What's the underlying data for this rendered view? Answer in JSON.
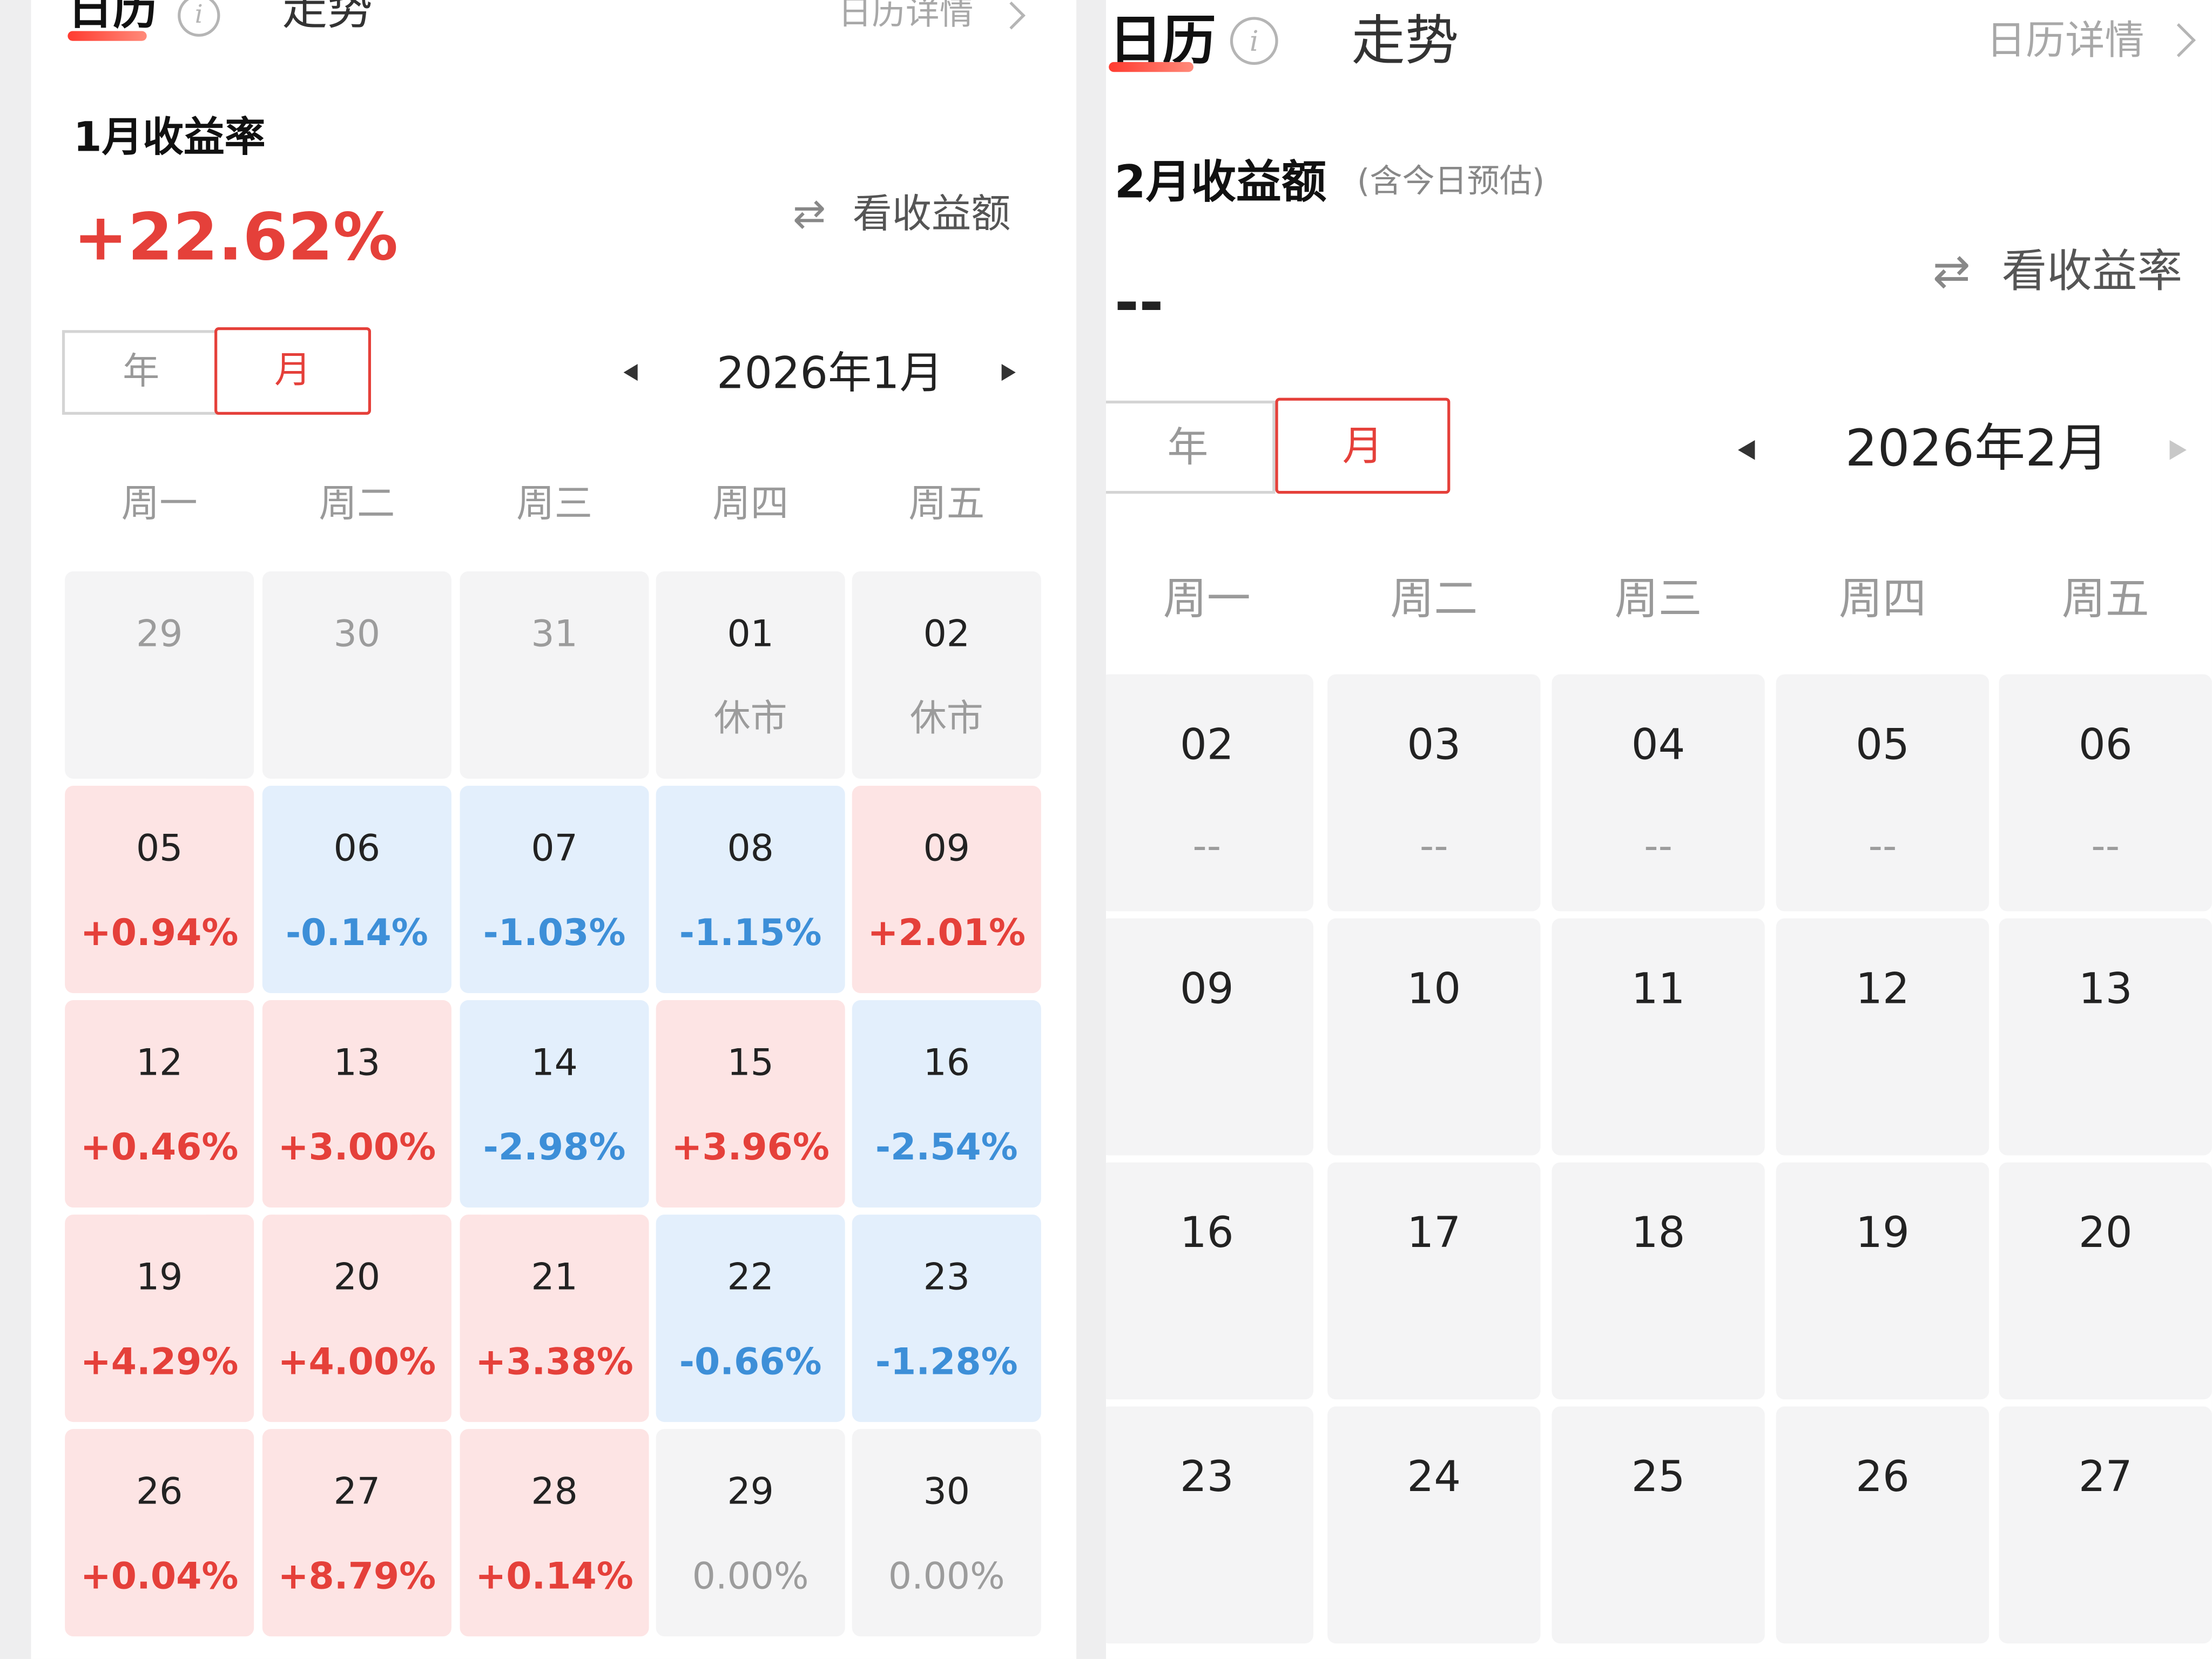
{
  "left": {
    "tabs": {
      "calendar": "日历",
      "trend": "走势"
    },
    "info_icon": "info-icon",
    "detail_link": "日历详情",
    "title": "1月收益率",
    "big_value": "+22.62%",
    "toggle_label": "看收益额",
    "segment": {
      "year": "年",
      "month": "月",
      "selected": "month"
    },
    "month_label": "2026年1月",
    "weekdays": [
      "周一",
      "周二",
      "周三",
      "周四",
      "周五"
    ],
    "weeks": [
      [
        {
          "day": "29",
          "value": "",
          "tone": "muted"
        },
        {
          "day": "30",
          "value": "",
          "tone": "muted"
        },
        {
          "day": "31",
          "value": "",
          "tone": "muted"
        },
        {
          "day": "01",
          "value": "休市",
          "tone": "gray"
        },
        {
          "day": "02",
          "value": "休市",
          "tone": "gray"
        }
      ],
      [
        {
          "day": "05",
          "value": "+0.94%",
          "tone": "red"
        },
        {
          "day": "06",
          "value": "-0.14%",
          "tone": "blue"
        },
        {
          "day": "07",
          "value": "-1.03%",
          "tone": "blue"
        },
        {
          "day": "08",
          "value": "-1.15%",
          "tone": "blue"
        },
        {
          "day": "09",
          "value": "+2.01%",
          "tone": "red"
        }
      ],
      [
        {
          "day": "12",
          "value": "+0.46%",
          "tone": "red"
        },
        {
          "day": "13",
          "value": "+3.00%",
          "tone": "red"
        },
        {
          "day": "14",
          "value": "-2.98%",
          "tone": "blue"
        },
        {
          "day": "15",
          "value": "+3.96%",
          "tone": "red"
        },
        {
          "day": "16",
          "value": "-2.54%",
          "tone": "blue"
        }
      ],
      [
        {
          "day": "19",
          "value": "+4.29%",
          "tone": "red"
        },
        {
          "day": "20",
          "value": "+4.00%",
          "tone": "red"
        },
        {
          "day": "21",
          "value": "+3.38%",
          "tone": "red"
        },
        {
          "day": "22",
          "value": "-0.66%",
          "tone": "blue"
        },
        {
          "day": "23",
          "value": "-1.28%",
          "tone": "blue"
        }
      ],
      [
        {
          "day": "26",
          "value": "+0.04%",
          "tone": "red"
        },
        {
          "day": "27",
          "value": "+8.79%",
          "tone": "red"
        },
        {
          "day": "28",
          "value": "+0.14%",
          "tone": "red"
        },
        {
          "day": "29",
          "value": "0.00%",
          "tone": "gray"
        },
        {
          "day": "30",
          "value": "0.00%",
          "tone": "gray"
        }
      ]
    ]
  },
  "right": {
    "tabs": {
      "calendar": "日历",
      "trend": "走势"
    },
    "info_icon": "info-icon",
    "detail_link": "日历详情",
    "title": "2月收益额",
    "title_hint": "(含今日预估)",
    "big_value": "--",
    "toggle_label": "看收益率",
    "segment": {
      "year": "年",
      "month": "月",
      "selected": "month"
    },
    "month_label": "2026年2月",
    "weekdays": [
      "周一",
      "周二",
      "周三",
      "周四",
      "周五"
    ],
    "weeks": [
      [
        {
          "day": "02",
          "value": "--",
          "tone": "gray"
        },
        {
          "day": "03",
          "value": "--",
          "tone": "gray"
        },
        {
          "day": "04",
          "value": "--",
          "tone": "gray"
        },
        {
          "day": "05",
          "value": "--",
          "tone": "gray"
        },
        {
          "day": "06",
          "value": "--",
          "tone": "gray"
        }
      ],
      [
        {
          "day": "09",
          "value": "",
          "tone": "gray"
        },
        {
          "day": "10",
          "value": "",
          "tone": "gray"
        },
        {
          "day": "11",
          "value": "",
          "tone": "gray"
        },
        {
          "day": "12",
          "value": "",
          "tone": "gray"
        },
        {
          "day": "13",
          "value": "",
          "tone": "gray"
        }
      ],
      [
        {
          "day": "16",
          "value": "",
          "tone": "gray"
        },
        {
          "day": "17",
          "value": "",
          "tone": "gray"
        },
        {
          "day": "18",
          "value": "",
          "tone": "gray"
        },
        {
          "day": "19",
          "value": "",
          "tone": "gray"
        },
        {
          "day": "20",
          "value": "",
          "tone": "gray"
        }
      ],
      [
        {
          "day": "23",
          "value": "",
          "tone": "gray"
        },
        {
          "day": "24",
          "value": "",
          "tone": "gray"
        },
        {
          "day": "25",
          "value": "",
          "tone": "gray"
        },
        {
          "day": "26",
          "value": "",
          "tone": "gray"
        },
        {
          "day": "27",
          "value": "",
          "tone": "gray"
        }
      ]
    ]
  },
  "colors": {
    "up": "#e5403a",
    "down": "#3d8fd8",
    "up_bg": "#fde4e4",
    "down_bg": "#e3effc",
    "neutral_bg": "#f4f4f5"
  }
}
